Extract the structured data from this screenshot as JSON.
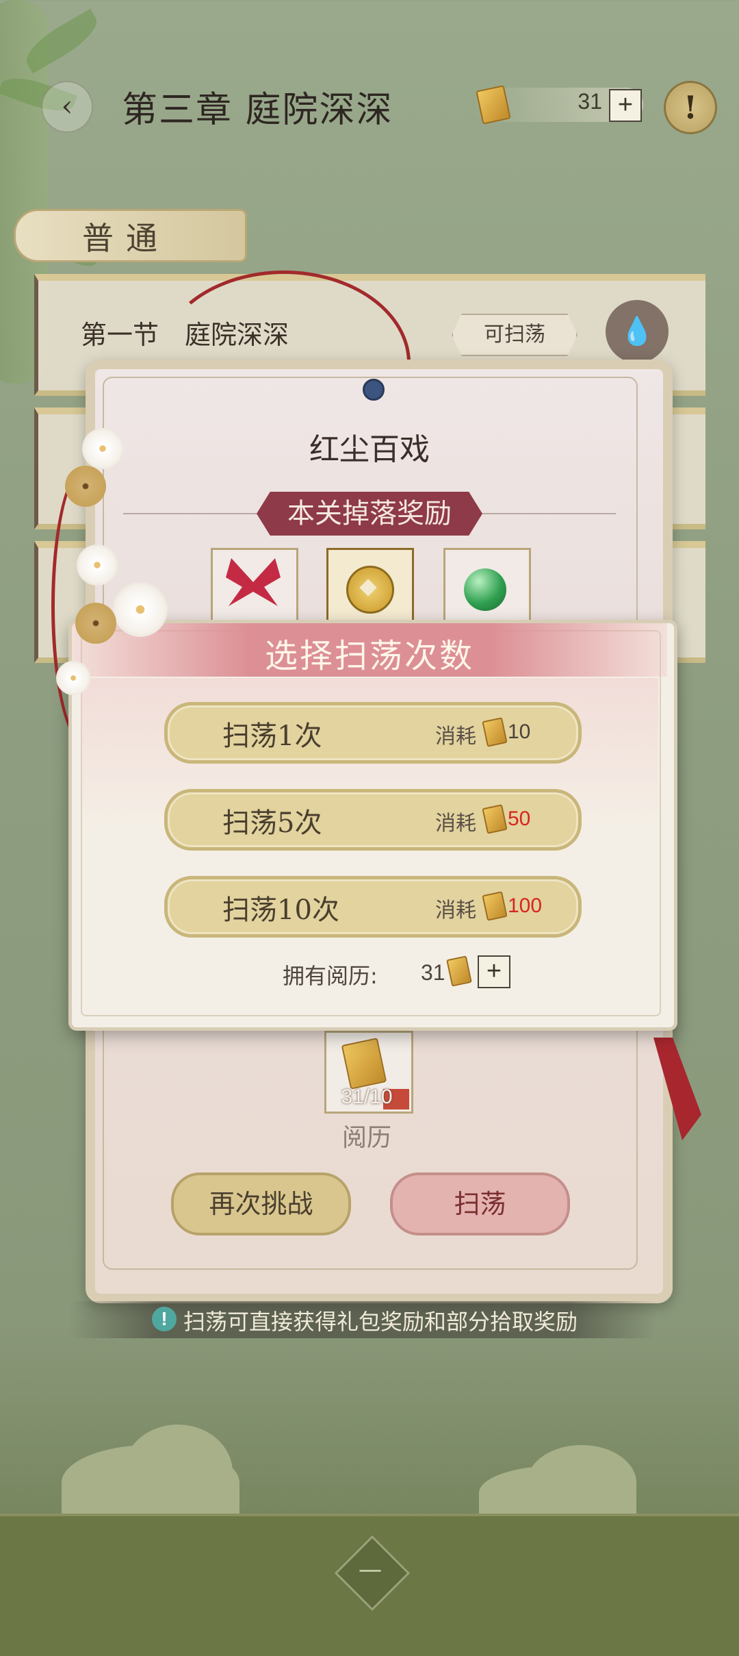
{
  "header": {
    "back_icon": "chevron-left-icon",
    "title": "第三章 庭院深深",
    "resource_count": "31",
    "plus_label": "+",
    "info_label": "!"
  },
  "tab": {
    "label": "普通"
  },
  "stage_list": {
    "first_row": {
      "title": "第一节　庭院深深",
      "badge": "可扫荡",
      "icon": "flame-icon"
    }
  },
  "stage_card": {
    "stage_name": "红尘百戏",
    "reward_banner": "本关掉落奖励",
    "reward_items": [
      "butterfly-icon",
      "coin-icon",
      "jade-orb-icon"
    ],
    "bottom_item": {
      "count": "31/10",
      "label": "阅历"
    },
    "retry_button": "再次挑战",
    "sweep_button": "扫荡"
  },
  "sweep_modal": {
    "title": "选择扫荡次数",
    "options": [
      {
        "label": "扫荡1次",
        "cost_label": "消耗",
        "cost": "10",
        "cost_color": "#4a4238"
      },
      {
        "label": "扫荡5次",
        "cost_label": "消耗",
        "cost": "50",
        "cost_color": "#d8251e"
      },
      {
        "label": "扫荡10次",
        "cost_label": "消耗",
        "cost": "100",
        "cost_color": "#d8251e"
      }
    ],
    "owned_label": "拥有阅历:",
    "owned_count": "31",
    "plus_label": "+"
  },
  "tip": {
    "text": "扫荡可直接获得礼包奖励和部分拾取奖励",
    "icon_label": "!"
  },
  "footer": {
    "diamond_label": "一"
  },
  "colors": {
    "accent_red": "#8e3a48",
    "gold_button": "#e2d39f",
    "pink_button": "#e3b3b0",
    "insufficient_cost": "#d8251e"
  }
}
